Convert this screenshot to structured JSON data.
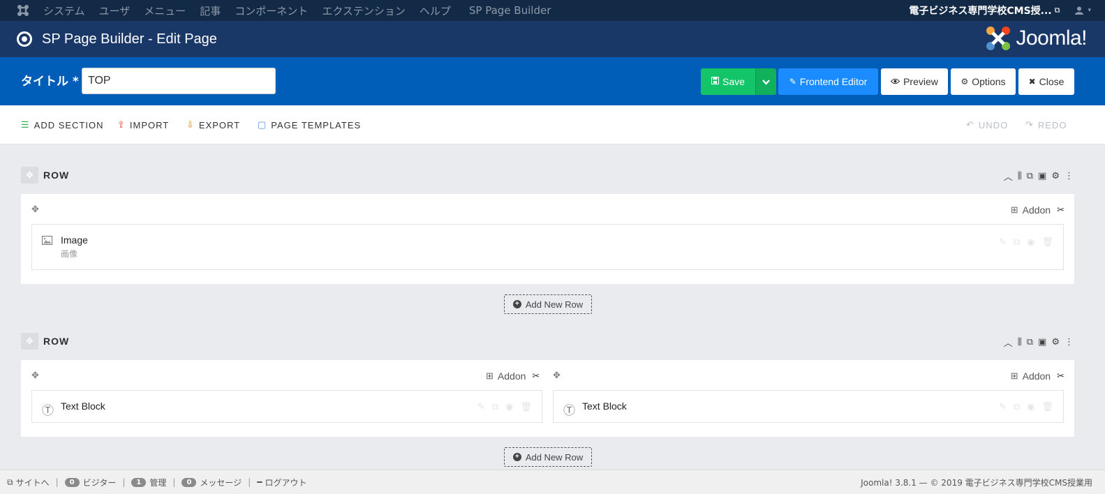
{
  "topbar": {
    "menu": [
      "システム",
      "ユーザ",
      "メニュー",
      "記事",
      "コンポーネント",
      "エクステンション",
      "ヘルプ"
    ],
    "component": "SP Page Builder",
    "site_name": "電子ビジネス専門学校CMS授...",
    "user_icon": "user-icon"
  },
  "header": {
    "title": "SP Page Builder - Edit Page",
    "brand": "Joomla!"
  },
  "toolbar": {
    "title_label": "タイトル *",
    "title_value": "TOP",
    "save": "Save",
    "frontend": "Frontend Editor",
    "preview": "Preview",
    "options": "Options",
    "close": "Close"
  },
  "actions": {
    "add_section": "ADD SECTION",
    "import": "IMPORT",
    "export": "EXPORT",
    "page_templates": "PAGE TEMPLATES",
    "undo": "UNDO",
    "redo": "REDO"
  },
  "rows": [
    {
      "label": "ROW",
      "addon_label": "Addon",
      "addons": [
        {
          "name": "Image",
          "subtitle": "画像",
          "icon": "image-icon"
        }
      ]
    },
    {
      "label": "ROW",
      "addon_label": "Addon",
      "addons": [
        {
          "name": "Text Block",
          "icon": "text-block-icon"
        },
        {
          "name": "Text Block",
          "icon": "text-block-icon"
        }
      ]
    }
  ],
  "add_new_row": "Add New Row",
  "statusbar": {
    "site": "サイトへ",
    "visitors_count": "0",
    "visitors": "ビジター",
    "admins_count": "1",
    "admins": "管理",
    "messages_count": "0",
    "messages": "メッセージ",
    "logout": "ログアウト",
    "copyright": "Joomla! 3.8.1 — © 2019 電子ビジネス専門学校CMS授業用"
  },
  "colors": {
    "topbar": "#132a47",
    "header": "#1a3867",
    "toolbar": "#005db8",
    "save": "#14c468",
    "frontend": "#1a8cff"
  }
}
